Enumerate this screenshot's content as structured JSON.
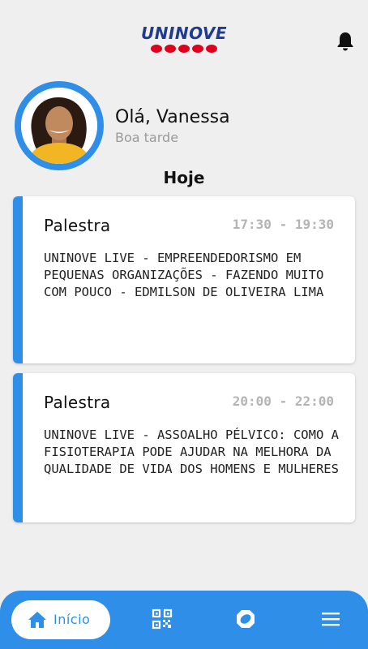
{
  "header": {
    "logo_text": "UNINOVE",
    "notifications_icon": "bell-icon"
  },
  "profile": {
    "greeting": "Olá, Vanessa",
    "subgreeting": "Boa tarde"
  },
  "schedule": {
    "section_title": "Hoje",
    "events": [
      {
        "type": "Palestra",
        "time": "17:30 - 19:30",
        "description": "UNINOVE LIVE - EMPREENDEDORISMO EM PEQUENAS ORGANIZAÇÕES - FAZENDO MUITO COM POUCO - EDMILSON DE OLIVEIRA LIMA"
      },
      {
        "type": "Palestra",
        "time": "20:00 - 22:00",
        "description": "UNINOVE LIVE - ASSOALHO PÉLVICO: COMO A FISIOTERAPIA PODE AJUDAR NA MELHORA DA QUALIDADE DE VIDA DOS HOMENS E MULHERES"
      }
    ]
  },
  "bottom_nav": {
    "home_label": "Início",
    "items": [
      "home-icon",
      "qr-code-icon",
      "ring-icon",
      "menu-icon"
    ]
  },
  "colors": {
    "accent": "#2f8fe8",
    "brand_blue": "#1f3a93",
    "brand_red": "#e0001b",
    "background": "#efefef"
  }
}
